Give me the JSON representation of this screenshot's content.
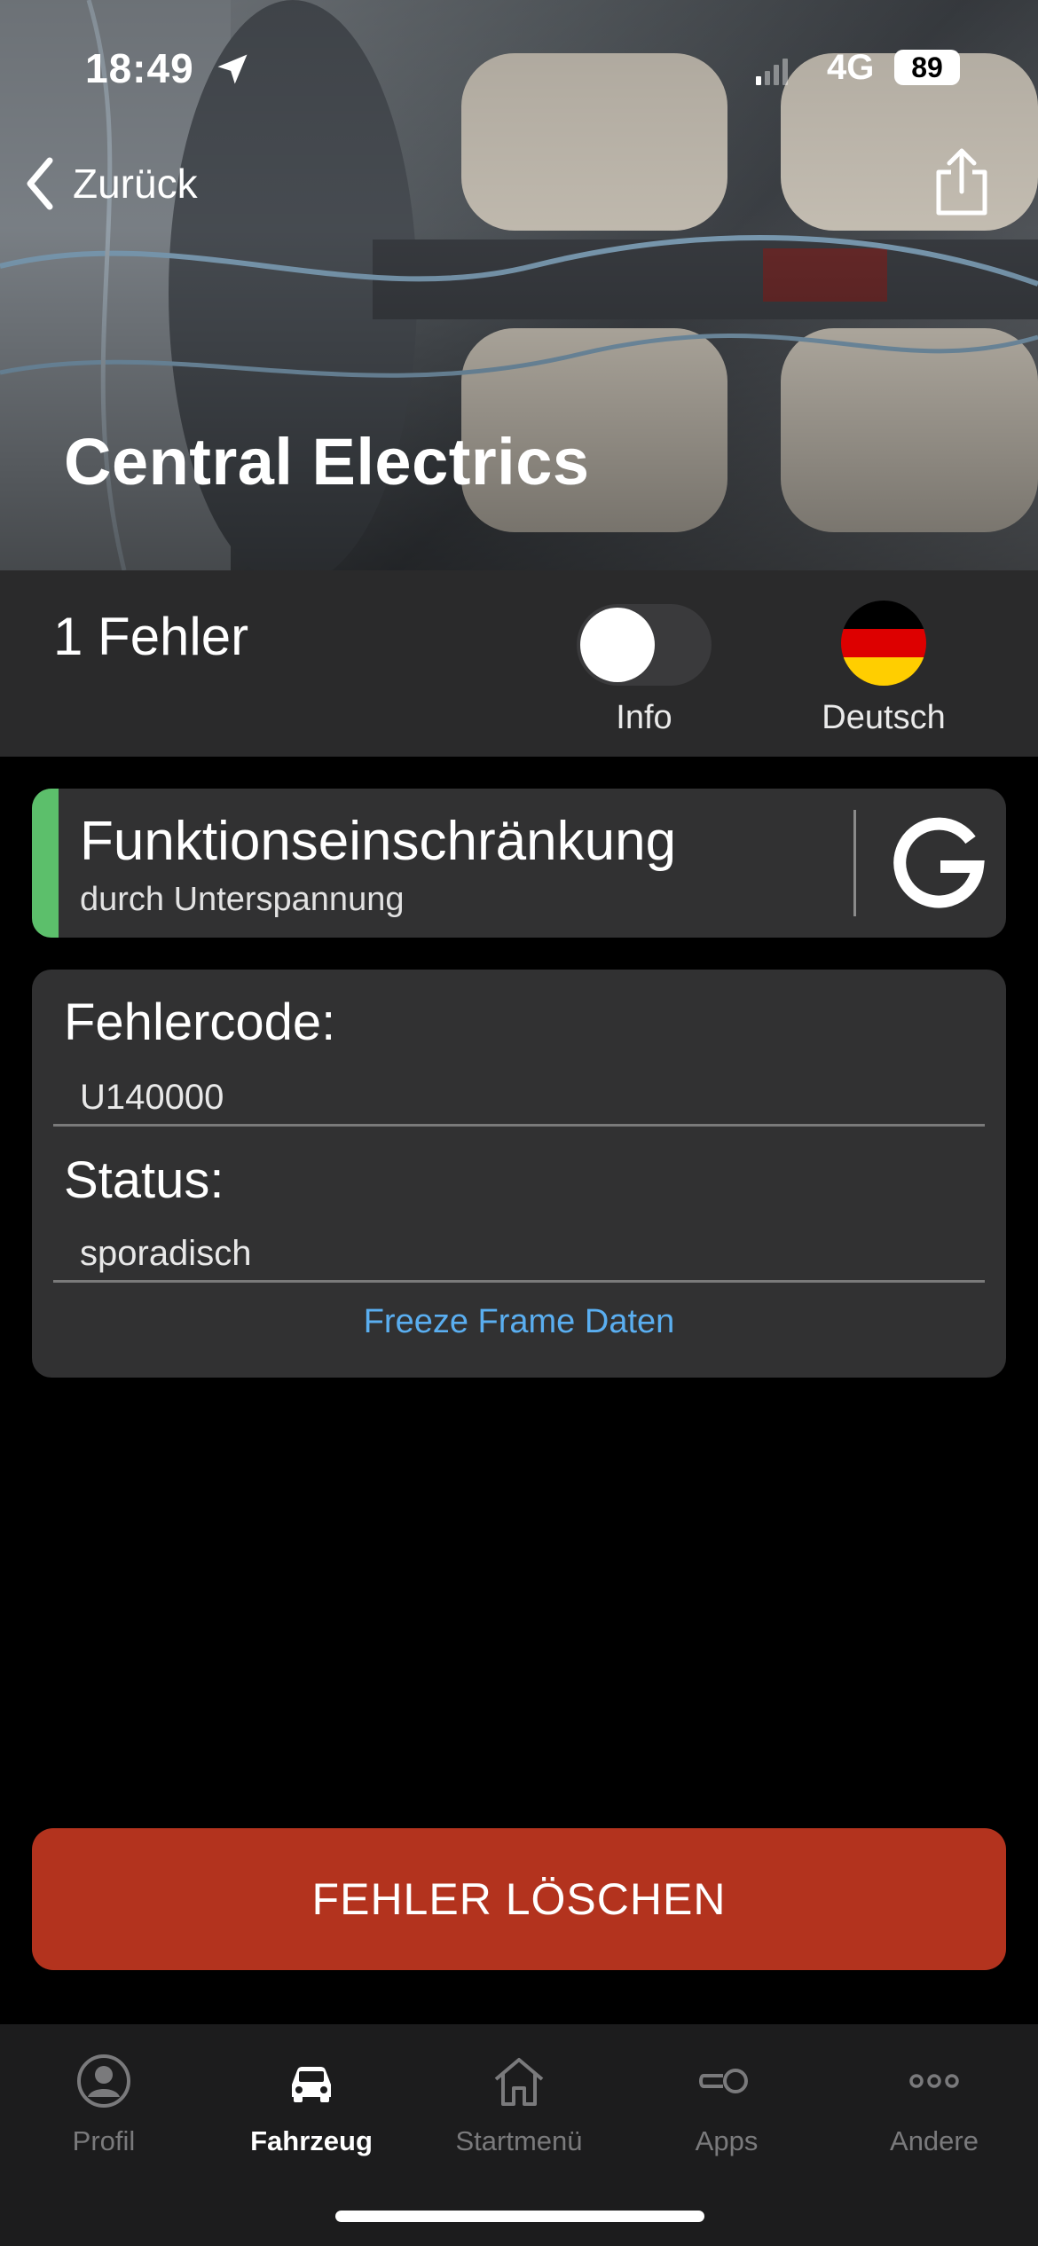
{
  "status_bar": {
    "time": "18:49",
    "network": "4G",
    "battery": "89"
  },
  "header": {
    "back_label": "Zurück",
    "title": "Central Electrics",
    "icons": {
      "back": "chevron-left-icon",
      "share": "share-icon",
      "location": "location-arrow-icon"
    }
  },
  "summary": {
    "fault_count": "1 Fehler",
    "toggle_label": "Info",
    "toggle_on": false,
    "language_label": "Deutsch",
    "flag_colors": [
      "#000000",
      "#dd0000",
      "#ffce00"
    ]
  },
  "fault": {
    "title": "Funktionseinschränkung",
    "subtitle": "durch Unterspannung",
    "accent_color": "#5cbf6b",
    "google_icon": "google-g-icon"
  },
  "details": {
    "code_label": "Fehlercode:",
    "code_value": "U140000",
    "status_label": "Status:",
    "status_value": "sporadisch",
    "freeze_frame_link": "Freeze Frame Daten"
  },
  "actions": {
    "delete_label": "FEHLER LÖSCHEN",
    "delete_color": "#b3331e"
  },
  "tabbar": {
    "active": "Fahrzeug",
    "items": [
      {
        "label": "Profil",
        "icon": "profile-icon"
      },
      {
        "label": "Fahrzeug",
        "icon": "car-icon"
      },
      {
        "label": "Startmenü",
        "icon": "home-icon"
      },
      {
        "label": "Apps",
        "icon": "apps-toggle-icon"
      },
      {
        "label": "Andere",
        "icon": "more-icon"
      }
    ]
  }
}
